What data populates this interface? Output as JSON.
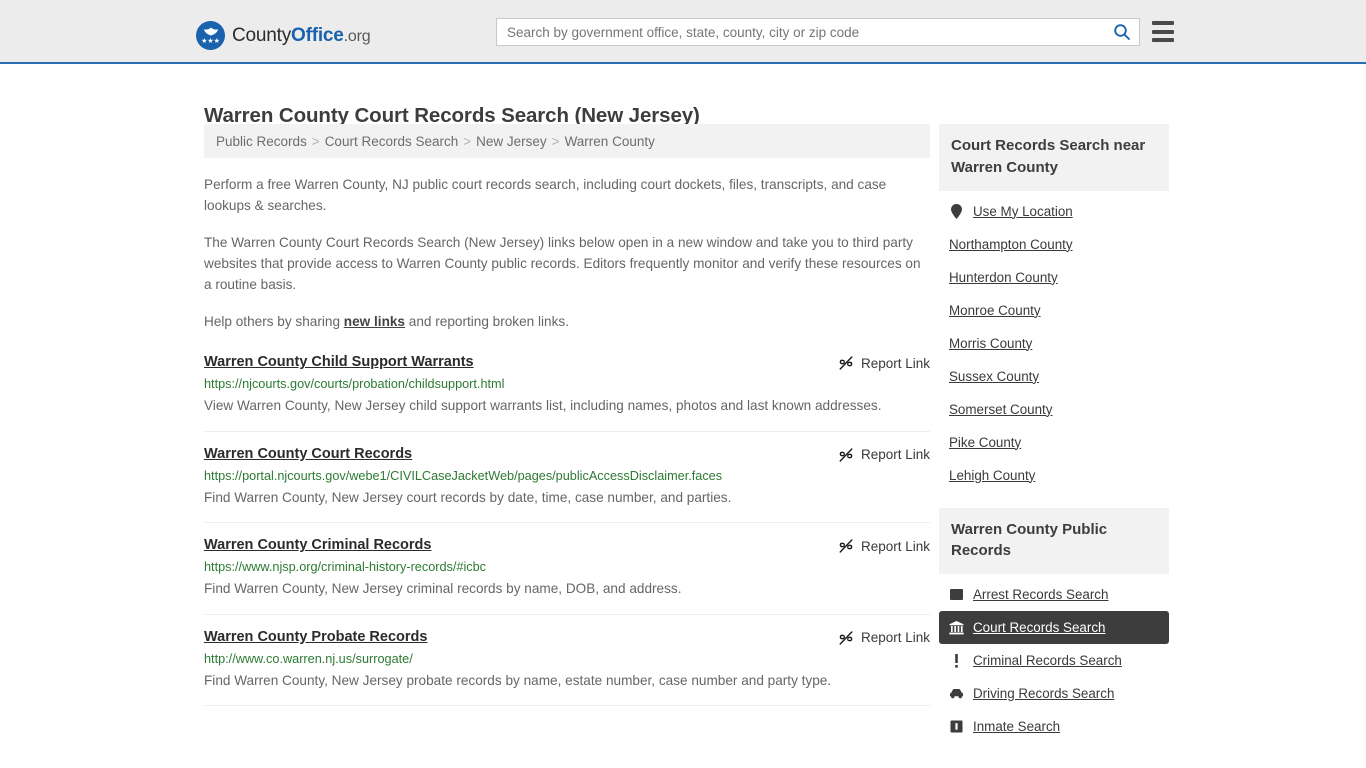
{
  "header": {
    "brand": {
      "part1": "County",
      "part2": "Office",
      "part3": ".org",
      "logo_icon": "eagle-stars-logo",
      "stars": "★★★"
    },
    "search": {
      "placeholder": "Search by government office, state, county, city or zip code",
      "value": "",
      "icon": "search-icon"
    },
    "menu_icon": "hamburger-menu-icon"
  },
  "page": {
    "title": "Warren County Court Records Search (New Jersey)"
  },
  "breadcrumb": {
    "separator": ">",
    "items": [
      {
        "label": "Public Records"
      },
      {
        "label": "Court Records Search"
      },
      {
        "label": "New Jersey"
      },
      {
        "label": "Warren County"
      }
    ]
  },
  "intro": {
    "p1": "Perform a free Warren County, NJ public court records search, including court dockets, files, transcripts, and case lookups & searches.",
    "p2": "The Warren County Court Records Search (New Jersey) links below open in a new window and take you to third party websites that provide access to Warren County public records. Editors frequently monitor and verify these resources on a routine basis.",
    "p3_before": "Help others by sharing ",
    "p3_link": "new links",
    "p3_after": " and reporting broken links."
  },
  "results": {
    "report_label": "Report Link",
    "report_icon": "broken-link-icon",
    "items": [
      {
        "title": "Warren County Child Support Warrants",
        "url": "https://njcourts.gov/courts/probation/childsupport.html",
        "description": "View Warren County, New Jersey child support warrants list, including names, photos and last known addresses."
      },
      {
        "title": "Warren County Court Records",
        "url": "https://portal.njcourts.gov/webe1/CIVILCaseJacketWeb/pages/publicAccessDisclaimer.faces",
        "description": "Find Warren County, New Jersey court records by date, time, case number, and parties."
      },
      {
        "title": "Warren County Criminal Records",
        "url": "https://www.njsp.org/criminal-history-records/#icbc",
        "description": "Find Warren County, New Jersey criminal records by name, DOB, and address."
      },
      {
        "title": "Warren County Probate Records",
        "url": "http://www.co.warren.nj.us/surrogate/",
        "description": "Find Warren County, New Jersey probate records by name, estate number, case number and party type."
      }
    ]
  },
  "sidebar": {
    "nearby": {
      "title": "Court Records Search near Warren County",
      "items": [
        {
          "label": "Use My Location",
          "icon": "map-pin-icon"
        },
        {
          "label": "Northampton County",
          "icon": ""
        },
        {
          "label": "Hunterdon County",
          "icon": ""
        },
        {
          "label": "Monroe County",
          "icon": ""
        },
        {
          "label": "Morris County",
          "icon": ""
        },
        {
          "label": "Sussex County",
          "icon": ""
        },
        {
          "label": "Somerset County",
          "icon": ""
        },
        {
          "label": "Pike County",
          "icon": ""
        },
        {
          "label": "Lehigh County",
          "icon": ""
        }
      ]
    },
    "public_records": {
      "title": "Warren County Public Records",
      "items": [
        {
          "label": "Arrest Records Search",
          "icon": "square-icon",
          "active": false
        },
        {
          "label": "Court Records Search",
          "icon": "courthouse-icon",
          "active": true
        },
        {
          "label": "Criminal Records Search",
          "icon": "exclamation-icon",
          "active": false
        },
        {
          "label": "Driving Records Search",
          "icon": "car-icon",
          "active": false
        },
        {
          "label": "Inmate Search",
          "icon": "jail-icon",
          "active": false
        }
      ]
    }
  },
  "colors": {
    "brand_blue": "#1a62ad",
    "header_bg": "#ececec",
    "header_border": "#2a6eb0",
    "url_green": "#2d7a33",
    "active_bg": "#3d3d3d"
  }
}
